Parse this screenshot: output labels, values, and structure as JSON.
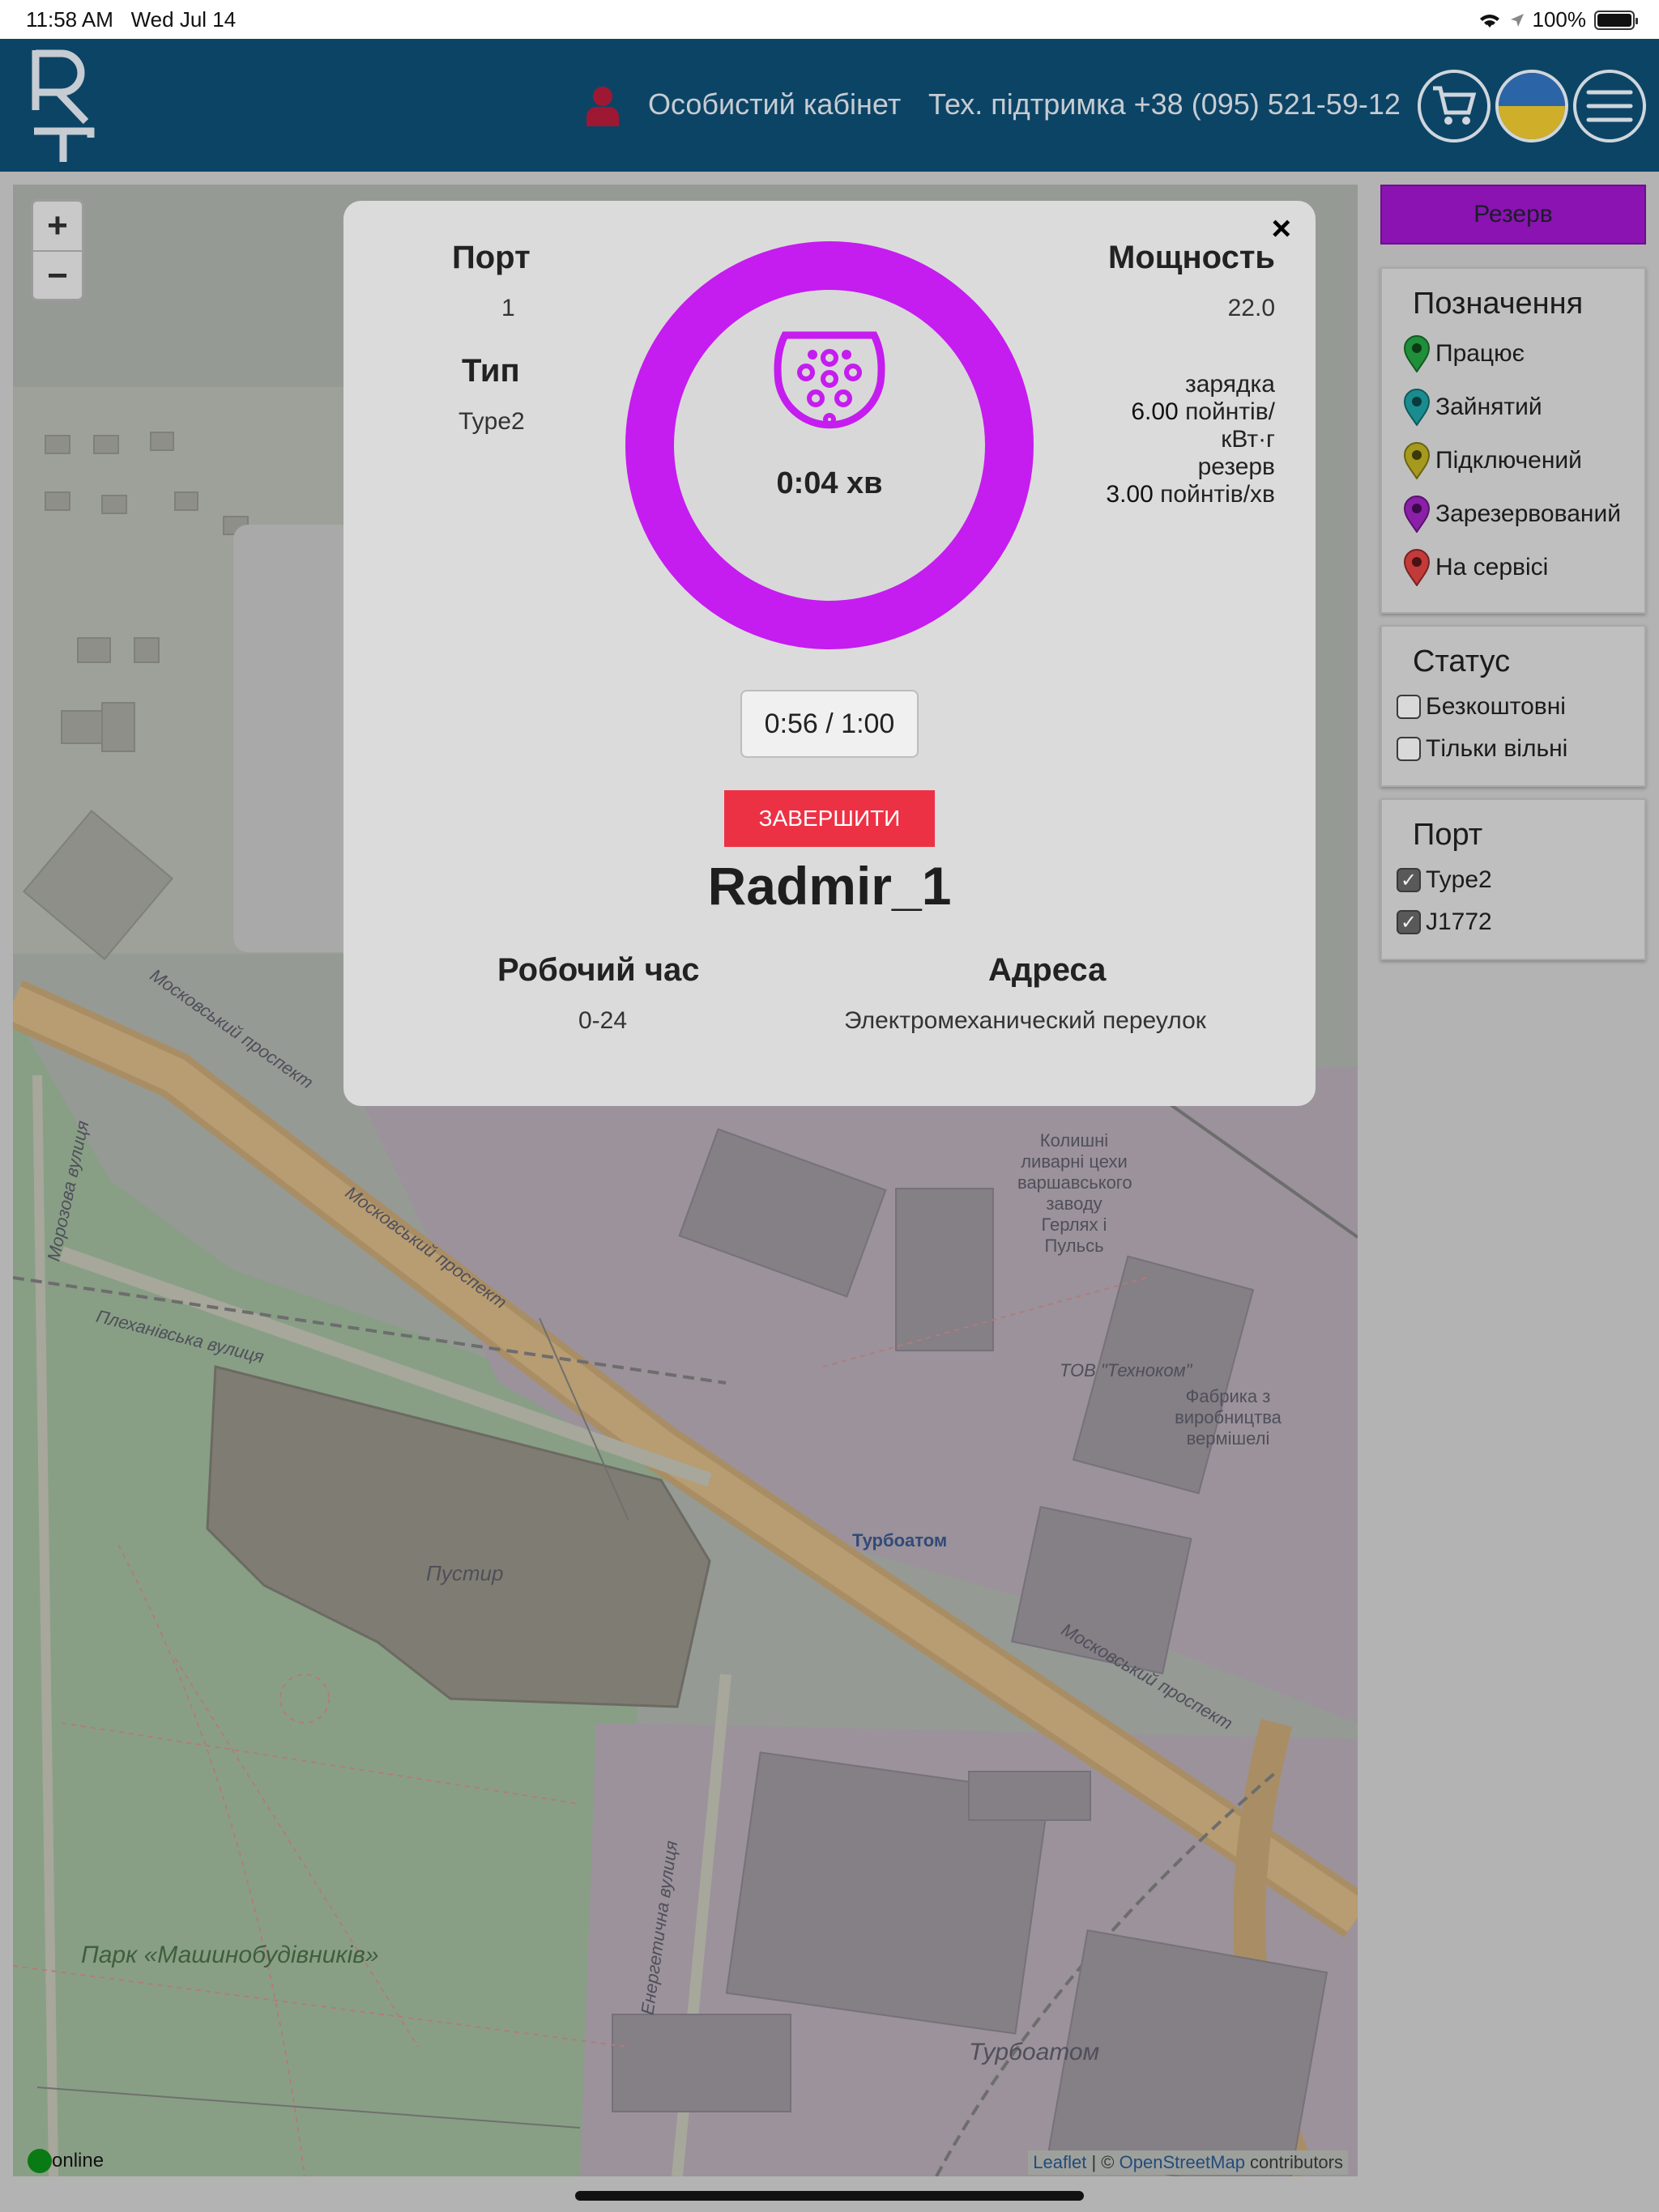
{
  "status_bar": {
    "time": "11:58 AM",
    "date": "Wed Jul 14",
    "battery": "100%"
  },
  "header": {
    "account_link": "Особистий кабінет",
    "support_link": "Тех. підтримка +38 (095) 521-59-12",
    "icons": [
      "user-icon",
      "cart-icon",
      "flag-ua-icon",
      "menu-icon"
    ]
  },
  "map": {
    "zoom_in": "+",
    "zoom_out": "−",
    "labels": {
      "prospect": "Московський проспект",
      "plekhanivska": "Плеханівська вулиця",
      "morozova": "Морозова вулиця",
      "pustyr": "Пустир",
      "turboatom": "Турбоатом",
      "park": "Парк «Машинобудівників»",
      "tov": "ТОВ \"Техноком\"",
      "factory": "Фабрика з виробництва вермішелі",
      "foundry": "Колишні ливарні цехи варшавського заводу Герлях і Пульсь",
      "energ": "Енергетична вулиця"
    },
    "attribution_leaflet": "Leaflet",
    "attribution_sep": " | © ",
    "attribution_osm": "OpenStreetMap",
    "attribution_tail": " contributors",
    "online": "online"
  },
  "modal": {
    "close": "×",
    "port_label": "Порт",
    "port_value": "1",
    "type_label": "Тип",
    "type_value": "Type2",
    "power_label": "Мощность",
    "power_value": "22.0",
    "charging_label": "зарядка",
    "charging_rate": "6.00",
    "charging_unit_1": "пойнтів/",
    "charging_unit_2": "кВт·г",
    "reserve_label": "резерв",
    "reserve_rate": "3.00",
    "reserve_unit": "пойнтів/хв",
    "elapsed": "0:04 хв",
    "ring_progress": 1.0,
    "timer": "0:56 / 1:00",
    "finish_button": "ЗАВЕРШИТИ",
    "station_name": "Radmir_1",
    "hours_label": "Робочий час",
    "hours_value": "0-24",
    "address_label": "Адреса",
    "address_value": "Электромеханический переулок"
  },
  "sidebar": {
    "reserve_button": "Резерв",
    "legend": {
      "title": "Позначення",
      "items": [
        {
          "label": "Працює",
          "color": "#1f8f3a"
        },
        {
          "label": "Зайнятий",
          "color": "#1a8c8f"
        },
        {
          "label": "Підключений",
          "color": "#a59a1e"
        },
        {
          "label": "Зарезервований",
          "color": "#8a1fa8"
        },
        {
          "label": "На сервісі",
          "color": "#c23a3a"
        }
      ]
    },
    "status": {
      "title": "Статус",
      "items": [
        {
          "label": "Безкоштовні",
          "checked": false
        },
        {
          "label": "Тільки вільні",
          "checked": false
        }
      ]
    },
    "port": {
      "title": "Порт",
      "items": [
        {
          "label": "Type2",
          "checked": true
        },
        {
          "label": "J1772",
          "checked": true
        }
      ]
    }
  }
}
